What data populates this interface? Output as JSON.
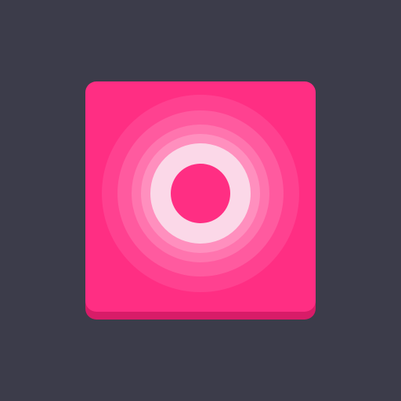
{
  "background_color": "#3c3c4a",
  "icon": {
    "name": "concentric-rings-app-icon",
    "tile_color": "#ff2e83",
    "tile_shadow_color": "#d81c68",
    "ring_colors": [
      "#ff4190",
      "#ff5a9f",
      "#ff74ae",
      "#ff8fbe",
      "#fbd8e8"
    ],
    "center_color": "#ff2e83"
  }
}
